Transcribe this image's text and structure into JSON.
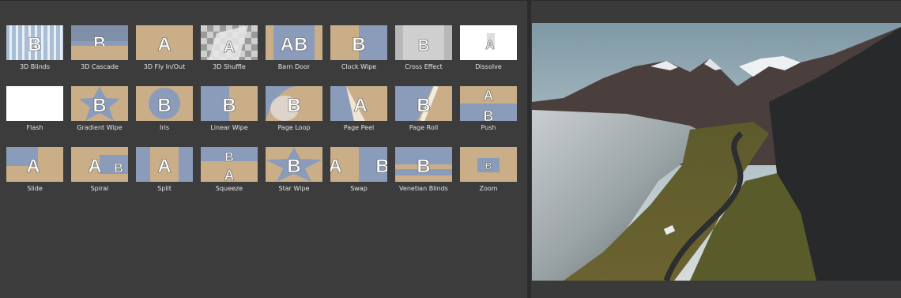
{
  "colors": {
    "tan": "#c9ae88",
    "blue": "#8b9cba",
    "panel": "#3c3c3c",
    "label": "#e6e6e6"
  },
  "transitions": [
    {
      "label": "3D Blinds",
      "style": "blinds"
    },
    {
      "label": "3D Cascade",
      "style": "cascade"
    },
    {
      "label": "3D Fly In/Out",
      "style": "fly"
    },
    {
      "label": "3D Shuffle",
      "style": "shuffle"
    },
    {
      "label": "Barn Door",
      "style": "barn"
    },
    {
      "label": "Clock Wipe",
      "style": "clock"
    },
    {
      "label": "Cross Effect",
      "style": "cross"
    },
    {
      "label": "Dissolve",
      "style": "dissolve"
    },
    {
      "label": "Flash",
      "style": "flash"
    },
    {
      "label": "Gradient Wipe",
      "style": "gradient"
    },
    {
      "label": "Iris",
      "style": "iris"
    },
    {
      "label": "Linear Wipe",
      "style": "linear"
    },
    {
      "label": "Page Loop",
      "style": "pageloop"
    },
    {
      "label": "Page Peel",
      "style": "pagepeel"
    },
    {
      "label": "Page Roll",
      "style": "pageroll"
    },
    {
      "label": "Push",
      "style": "push"
    },
    {
      "label": "Slide",
      "style": "slide"
    },
    {
      "label": "Spiral",
      "style": "spiral"
    },
    {
      "label": "Split",
      "style": "split"
    },
    {
      "label": "Squeeze",
      "style": "squeeze"
    },
    {
      "label": "Star Wipe",
      "style": "star"
    },
    {
      "label": "Swap",
      "style": "swap"
    },
    {
      "label": "Venetian Blinds",
      "style": "venetian"
    },
    {
      "label": "Zoom",
      "style": "zoom"
    }
  ]
}
